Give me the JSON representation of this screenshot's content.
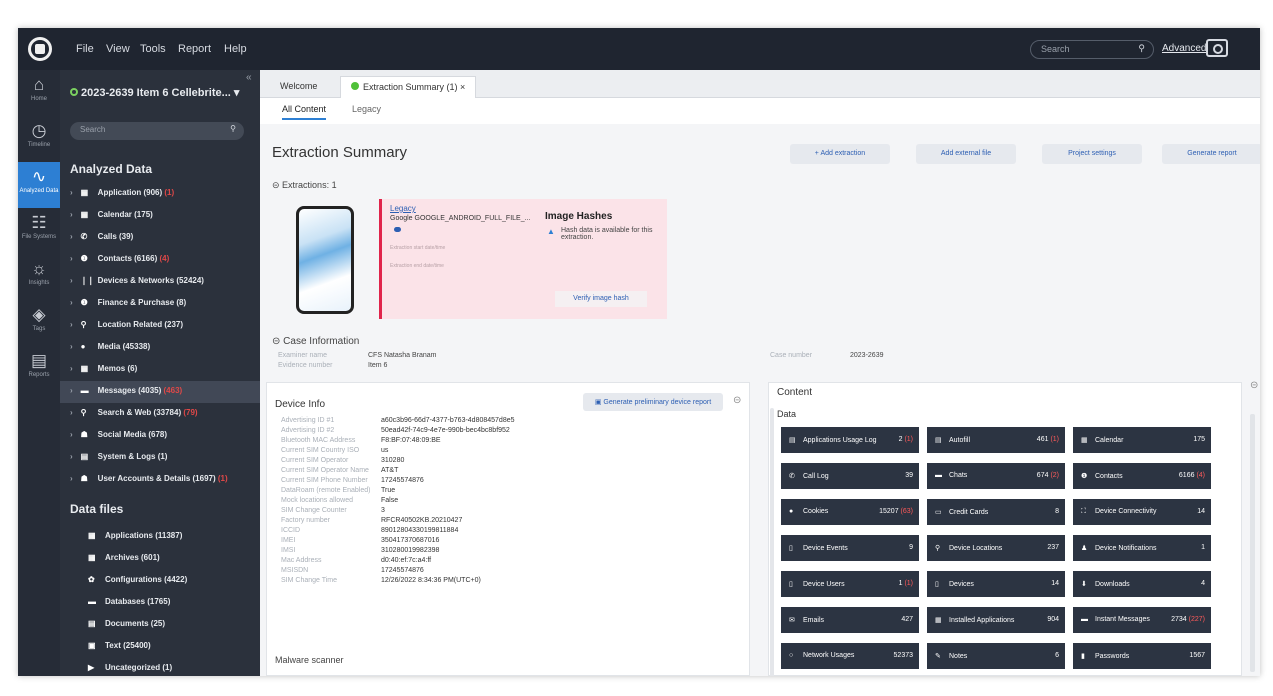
{
  "menu": [
    "File",
    "View",
    "Tools",
    "Report",
    "Help"
  ],
  "top": {
    "search_placeholder": "Search",
    "advanced": "Advanced"
  },
  "rail": [
    {
      "icon": "⌂",
      "label": "Home"
    },
    {
      "icon": "◷",
      "label": "Timeline"
    },
    {
      "icon": "∿",
      "label": "Analyzed Data"
    },
    {
      "icon": "☷",
      "label": "File Systems"
    },
    {
      "icon": "☼",
      "label": "Insights"
    },
    {
      "icon": "◈",
      "label": "Tags"
    },
    {
      "icon": "▤",
      "label": "Reports"
    }
  ],
  "sidebar": {
    "project": "2023-2639 Item 6 Cellebrite...",
    "search_placeholder": "Search",
    "analyzed_title": "Analyzed Data",
    "analyzed": [
      {
        "icon": "▦",
        "name": "Application (906)",
        "badge": "(1)"
      },
      {
        "icon": "▦",
        "name": "Calendar (175)",
        "badge": ""
      },
      {
        "icon": "✆",
        "name": "Calls (39)",
        "badge": ""
      },
      {
        "icon": "❶",
        "name": "Contacts (6166)",
        "badge": "(4)"
      },
      {
        "icon": "❘❘",
        "name": "Devices & Networks (52424)",
        "badge": ""
      },
      {
        "icon": "❶",
        "name": "Finance & Purchase (8)",
        "badge": ""
      },
      {
        "icon": "⚲",
        "name": "Location Related (237)",
        "badge": ""
      },
      {
        "icon": "●",
        "name": "Media (45338)",
        "badge": ""
      },
      {
        "icon": "▦",
        "name": "Memos (6)",
        "badge": ""
      },
      {
        "icon": "▬",
        "name": "Messages (4035)",
        "badge": "(463)"
      },
      {
        "icon": "⚲",
        "name": "Search & Web (33784)",
        "badge": "(79)"
      },
      {
        "icon": "☗",
        "name": "Social Media (678)",
        "badge": ""
      },
      {
        "icon": "▤",
        "name": "System & Logs (1)",
        "badge": ""
      },
      {
        "icon": "☗",
        "name": "User Accounts & Details (1697)",
        "badge": "(1)"
      }
    ],
    "files_title": "Data files",
    "files": [
      {
        "icon": "▦",
        "name": "Applications (11387)"
      },
      {
        "icon": "▦",
        "name": "Archives (601)"
      },
      {
        "icon": "✿",
        "name": "Configurations (4422)"
      },
      {
        "icon": "▬",
        "name": "Databases (1765)"
      },
      {
        "icon": "▤",
        "name": "Documents (25)"
      },
      {
        "icon": "▣",
        "name": "Text (25400)"
      },
      {
        "icon": "▶",
        "name": "Uncategorized (1)"
      }
    ]
  },
  "tabs": {
    "welcome": "Welcome",
    "summary": "Extraction Summary (1)",
    "close": "×"
  },
  "subtabs": {
    "all": "All Content",
    "legacy": "Legacy"
  },
  "page": {
    "title": "Extraction Summary",
    "add_extraction": "+ Add extraction",
    "add_external": "Add external file",
    "project_settings": "Project settings",
    "generate_report": "Generate report",
    "extractions_label": "Extractions: 1"
  },
  "extraction": {
    "link": "Legacy",
    "name": "Google GOOGLE_ANDROID_FULL_FILE_...",
    "line1": "Extraction start date/time",
    "line2": "Extraction end date/time"
  },
  "hashes": {
    "title": "Image Hashes",
    "warning": "Hash data is available for this extraction.",
    "verify": "Verify image hash"
  },
  "case": {
    "title": "Case Information",
    "examiner_label": "Examiner name",
    "examiner": "CFS Natasha Branam",
    "evidence_label": "Evidence number",
    "evidence": "Item 6",
    "casenum_label": "Case number",
    "casenum": "2023-2639"
  },
  "device": {
    "title": "Device Info",
    "generate": "Generate preliminary device report",
    "rows": [
      {
        "k": "Advertising ID #1",
        "v": "a60c3b96-66d7-4377-b763-4d808457d8e5"
      },
      {
        "k": "Advertising ID #2",
        "v": "50ead42f-74c9-4e7e-990b-bec4bc8bf952"
      },
      {
        "k": "Bluetooth MAC Address",
        "v": "F8:BF:07:48:09:BE"
      },
      {
        "k": "Current SIM Country ISO",
        "v": "us"
      },
      {
        "k": "Current SIM Operator",
        "v": "310280"
      },
      {
        "k": "Current SIM Operator Name",
        "v": "AT&T"
      },
      {
        "k": "Current SIM Phone Number",
        "v": "17245574876"
      },
      {
        "k": "DataRoam (remote Enabled)",
        "v": "True"
      },
      {
        "k": "Mock locations allowed",
        "v": "False"
      },
      {
        "k": "SIM Change Counter",
        "v": "3"
      },
      {
        "k": "Factory number",
        "v": "RFCR40502KB.20210427"
      },
      {
        "k": "ICCID",
        "v": "89012804330199811884"
      },
      {
        "k": "IMEI",
        "v": "350417370687016"
      },
      {
        "k": "IMSI",
        "v": "310280019982398"
      },
      {
        "k": "Mac Address",
        "v": "d0:40:ef:7c:a4:ff"
      },
      {
        "k": "MSISDN",
        "v": "17245574876"
      },
      {
        "k": "SIM Change Time",
        "v": "12/26/2022 8:34:36 PM(UTC+0)"
      }
    ],
    "malware": "Malware scanner"
  },
  "content": {
    "title": "Content",
    "data_label": "Data",
    "tiles": [
      {
        "icon": "▤",
        "name": "Applications Usage Log",
        "count": "2",
        "badge": "(1)"
      },
      {
        "icon": "▤",
        "name": "Autofill",
        "count": "461",
        "badge": "(1)"
      },
      {
        "icon": "▦",
        "name": "Calendar",
        "count": "175",
        "badge": ""
      },
      {
        "icon": "✆",
        "name": "Call Log",
        "count": "39",
        "badge": ""
      },
      {
        "icon": "▬",
        "name": "Chats",
        "count": "674",
        "badge": "(2)"
      },
      {
        "icon": "❶",
        "name": "Contacts",
        "count": "6166",
        "badge": "(4)"
      },
      {
        "icon": "●",
        "name": "Cookies",
        "count": "15207",
        "badge": "(63)"
      },
      {
        "icon": "▭",
        "name": "Credit Cards",
        "count": "8",
        "badge": ""
      },
      {
        "icon": "⛶",
        "name": "Device Connectivity",
        "count": "14",
        "badge": ""
      },
      {
        "icon": "▯",
        "name": "Device Events",
        "count": "9",
        "badge": ""
      },
      {
        "icon": "⚲",
        "name": "Device Locations",
        "count": "237",
        "badge": ""
      },
      {
        "icon": "♟",
        "name": "Device Notifications",
        "count": "1",
        "badge": ""
      },
      {
        "icon": "▯",
        "name": "Device Users",
        "count": "1",
        "badge": "(1)"
      },
      {
        "icon": "▯",
        "name": "Devices",
        "count": "14",
        "badge": ""
      },
      {
        "icon": "⬇",
        "name": "Downloads",
        "count": "4",
        "badge": ""
      },
      {
        "icon": "✉",
        "name": "Emails",
        "count": "427",
        "badge": ""
      },
      {
        "icon": "▦",
        "name": "Installed Applications",
        "count": "904",
        "badge": ""
      },
      {
        "icon": "▬",
        "name": "Instant Messages",
        "count": "2734",
        "badge": "(227)"
      },
      {
        "icon": "○",
        "name": "Network Usages",
        "count": "52373",
        "badge": ""
      },
      {
        "icon": "✎",
        "name": "Notes",
        "count": "6",
        "badge": ""
      },
      {
        "icon": "▮",
        "name": "Passwords",
        "count": "1567",
        "badge": ""
      }
    ]
  }
}
